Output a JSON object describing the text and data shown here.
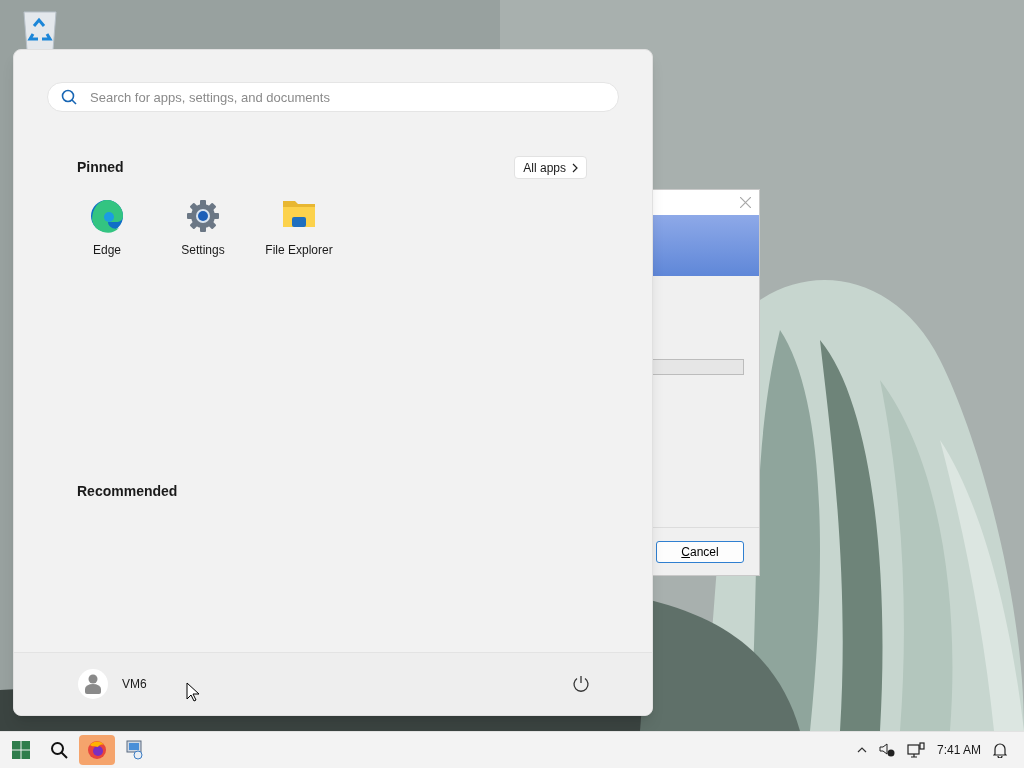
{
  "start_menu": {
    "search": {
      "placeholder": "Search for apps, settings, and documents"
    },
    "pinned": {
      "title": "Pinned",
      "all_apps": "All apps",
      "apps": [
        {
          "label": "Edge",
          "kind": "edge"
        },
        {
          "label": "Settings",
          "kind": "settings"
        },
        {
          "label": "File Explorer",
          "kind": "explorer"
        }
      ]
    },
    "recommended": {
      "title": "Recommended"
    },
    "user": {
      "name": "VM6"
    }
  },
  "dialog": {
    "buttons": [
      "Cancel"
    ]
  },
  "taskbar": {
    "items": [
      {
        "kind": "start",
        "selected": false
      },
      {
        "kind": "search",
        "selected": false
      },
      {
        "kind": "firefox",
        "selected": true
      },
      {
        "kind": "app",
        "selected": false
      }
    ],
    "clock": "7:41 AM"
  }
}
